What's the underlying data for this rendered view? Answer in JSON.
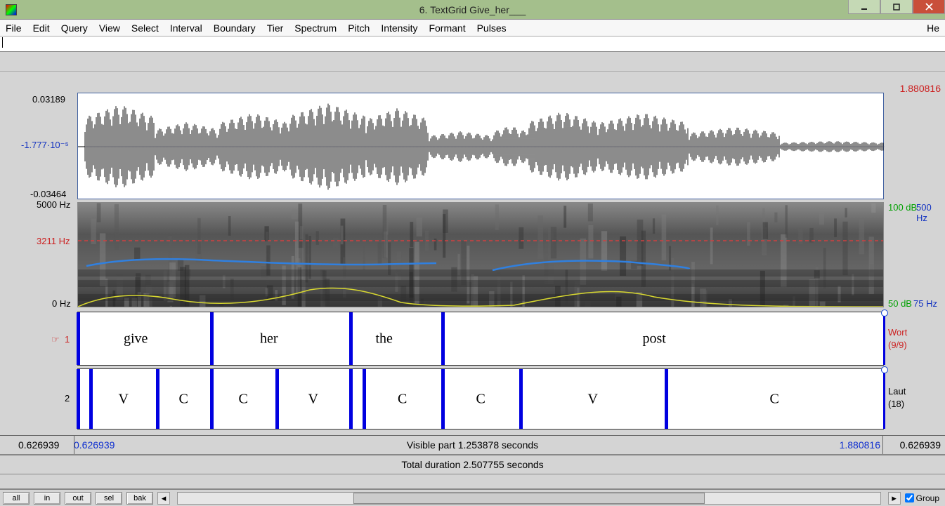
{
  "window": {
    "title": "6. TextGrid Give_her___"
  },
  "menu": {
    "items": [
      "File",
      "Edit",
      "Query",
      "View",
      "Select",
      "Interval",
      "Boundary",
      "Tier",
      "Spectrum",
      "Pitch",
      "Intensity",
      "Formant",
      "Pulses"
    ],
    "right": "He"
  },
  "waveform": {
    "ymax": "0.03189",
    "ycenter": "-1.777·10⁻⁵",
    "ymin": "-0.03464"
  },
  "spectrogram": {
    "freqmax": "5000 Hz",
    "formant_cursor": "3211 Hz",
    "freqmin": "0 Hz",
    "db_top": "100 dB",
    "db_bot": "50 dB",
    "pitch_top": "500 Hz",
    "pitch_bot": "75 Hz"
  },
  "cursor_end_time": "1.880816",
  "tiers": {
    "tier1_index": "1",
    "tier1_name": "Wort",
    "tier1_count": "(9/9)",
    "tier2_index": "2",
    "tier2_name": "Laut",
    "tier2_count": "(18)",
    "words": [
      {
        "label": "give",
        "start": 0,
        "end": 190
      },
      {
        "label": "her",
        "start": 190,
        "end": 388
      },
      {
        "label": "the",
        "start": 388,
        "end": 519
      },
      {
        "label": "post",
        "start": 519,
        "end": 1148
      }
    ],
    "segments": [
      {
        "label": "",
        "start": 0,
        "end": 18
      },
      {
        "label": "V",
        "start": 18,
        "end": 113
      },
      {
        "label": "C",
        "start": 113,
        "end": 190
      },
      {
        "label": "C",
        "start": 190,
        "end": 283
      },
      {
        "label": "V",
        "start": 283,
        "end": 388
      },
      {
        "label": "",
        "start": 388,
        "end": 407
      },
      {
        "label": "C",
        "start": 407,
        "end": 519
      },
      {
        "label": "C",
        "start": 519,
        "end": 630
      },
      {
        "label": "V",
        "start": 630,
        "end": 837
      },
      {
        "label": "C",
        "start": 837,
        "end": 1148
      }
    ]
  },
  "timeaxis": {
    "left_pad": "0.626939",
    "vis_start": "0.626939",
    "vis_text": "Visible part 1.253878 seconds",
    "vis_end": "1.880816",
    "right_pad": "0.626939",
    "total": "Total duration 2.507755 seconds"
  },
  "footer": {
    "buttons": [
      "all",
      "in",
      "out",
      "sel",
      "bak"
    ],
    "group": "Group"
  },
  "chart_data": {
    "type": "waveform+spectrogram+textgrid",
    "time_range_seconds": [
      0.626939,
      1.880816
    ],
    "waveform_amplitude_range": [
      -0.03464,
      0.03189
    ],
    "spectrogram_freq_range_hz": [
      0,
      5000
    ],
    "intensity_range_db": [
      50,
      100
    ],
    "pitch_range_hz": [
      75,
      500
    ],
    "formant_cursor_hz": 3211,
    "total_duration_seconds": 2.507755,
    "tier1_intervals": [
      "give",
      "her",
      "the",
      "post"
    ],
    "tier2_intervals": [
      "",
      "V",
      "C",
      "C",
      "V",
      "",
      "C",
      "C",
      "V",
      "C"
    ]
  }
}
